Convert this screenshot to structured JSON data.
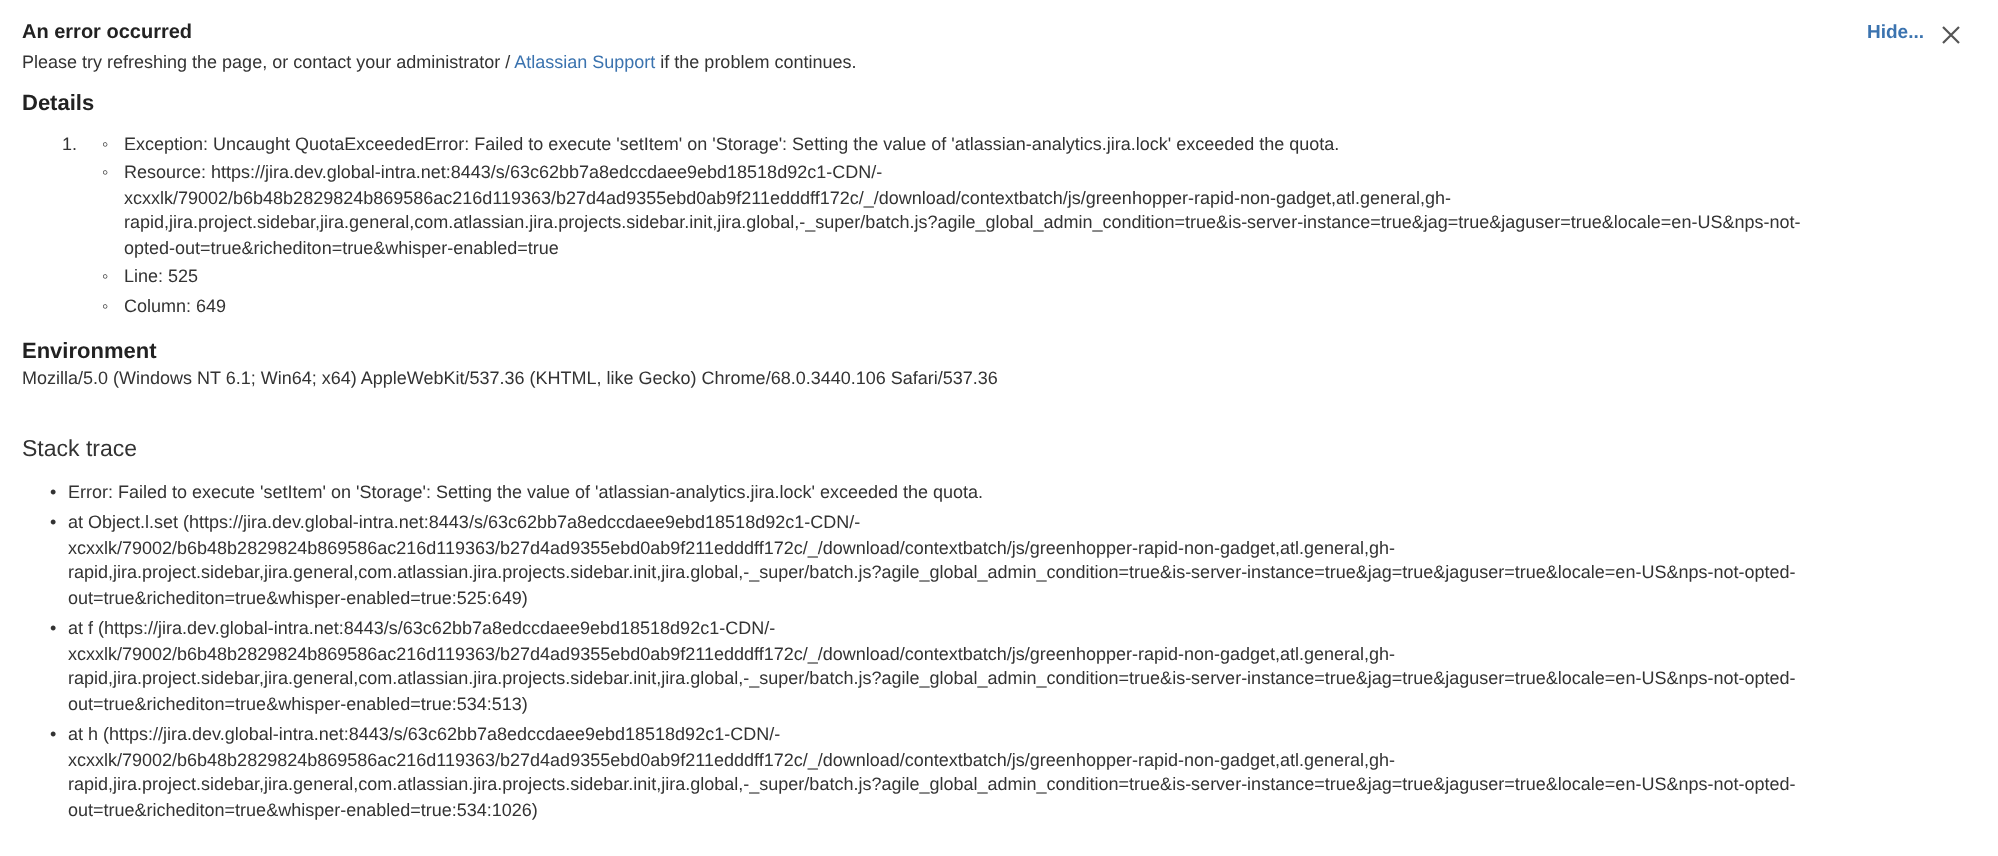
{
  "header": {
    "title": "An error occurred",
    "message_before": "Please try refreshing the page, or contact your administrator / ",
    "link": "Atlassian Support",
    "message_after": " if the problem continues.",
    "hide": "Hide..."
  },
  "details": {
    "heading": "Details",
    "items": [
      {
        "number": "1.",
        "marker": "◦",
        "entries": [
          {
            "lines": [
              "Exception: Uncaught QuotaExceededError: Failed to execute 'setItem' on 'Storage': Setting the value of 'atlassian-analytics.jira.lock' exceeded the quota."
            ]
          },
          {
            "lines": [
              "Resource: https://jira.dev.global-intra.net:8443/s/63c62bb7a8edccdaee9ebd18518d92c1-CDN/-",
              "xcxxlk/79002/b6b48b2829824b869586ac216d119363/b27d4ad9355ebd0ab9f211edddff172c/_/download/contextbatch/js/greenhopper-rapid-non-gadget,atl.general,gh-",
              "rapid,jira.project.sidebar,jira.general,com.atlassian.jira.projects.sidebar.init,jira.global,-_super/batch.js?agile_global_admin_condition=true&is-server-instance=true&jag=true&jaguser=true&locale=en-US&nps-not-",
              "opted-out=true&richediton=true&whisper-enabled=true"
            ]
          },
          {
            "lines": [
              "Line: 525"
            ]
          },
          {
            "lines": [
              "Column: 649"
            ]
          }
        ]
      }
    ]
  },
  "environment": {
    "heading": "Environment",
    "text": "Mozilla/5.0 (Windows NT 6.1; Win64; x64) AppleWebKit/537.36 (KHTML, like Gecko) Chrome/68.0.3440.106 Safari/537.36"
  },
  "stack_trace": {
    "heading": "Stack trace",
    "marker": "•",
    "items": [
      {
        "lines": [
          "Error: Failed to execute 'setItem' on 'Storage': Setting the value of 'atlassian-analytics.jira.lock' exceeded the quota."
        ]
      },
      {
        "lines": [
          "at Object.l.set (https://jira.dev.global-intra.net:8443/s/63c62bb7a8edccdaee9ebd18518d92c1-CDN/-",
          "xcxxlk/79002/b6b48b2829824b869586ac216d119363/b27d4ad9355ebd0ab9f211edddff172c/_/download/contextbatch/js/greenhopper-rapid-non-gadget,atl.general,gh-",
          "rapid,jira.project.sidebar,jira.general,com.atlassian.jira.projects.sidebar.init,jira.global,-_super/batch.js?agile_global_admin_condition=true&is-server-instance=true&jag=true&jaguser=true&locale=en-US&nps-not-opted-",
          "out=true&richediton=true&whisper-enabled=true:525:649)"
        ]
      },
      {
        "lines": [
          "at f (https://jira.dev.global-intra.net:8443/s/63c62bb7a8edccdaee9ebd18518d92c1-CDN/-",
          "xcxxlk/79002/b6b48b2829824b869586ac216d119363/b27d4ad9355ebd0ab9f211edddff172c/_/download/contextbatch/js/greenhopper-rapid-non-gadget,atl.general,gh-",
          "rapid,jira.project.sidebar,jira.general,com.atlassian.jira.projects.sidebar.init,jira.global,-_super/batch.js?agile_global_admin_condition=true&is-server-instance=true&jag=true&jaguser=true&locale=en-US&nps-not-opted-",
          "out=true&richediton=true&whisper-enabled=true:534:513)"
        ]
      },
      {
        "lines": [
          "at h (https://jira.dev.global-intra.net:8443/s/63c62bb7a8edccdaee9ebd18518d92c1-CDN/-",
          "xcxxlk/79002/b6b48b2829824b869586ac216d119363/b27d4ad9355ebd0ab9f211edddff172c/_/download/contextbatch/js/greenhopper-rapid-non-gadget,atl.general,gh-",
          "rapid,jira.project.sidebar,jira.general,com.atlassian.jira.projects.sidebar.init,jira.global,-_super/batch.js?agile_global_admin_condition=true&is-server-instance=true&jag=true&jaguser=true&locale=en-US&nps-not-opted-",
          "out=true&richediton=true&whisper-enabled=true:534:1026)"
        ]
      }
    ]
  }
}
